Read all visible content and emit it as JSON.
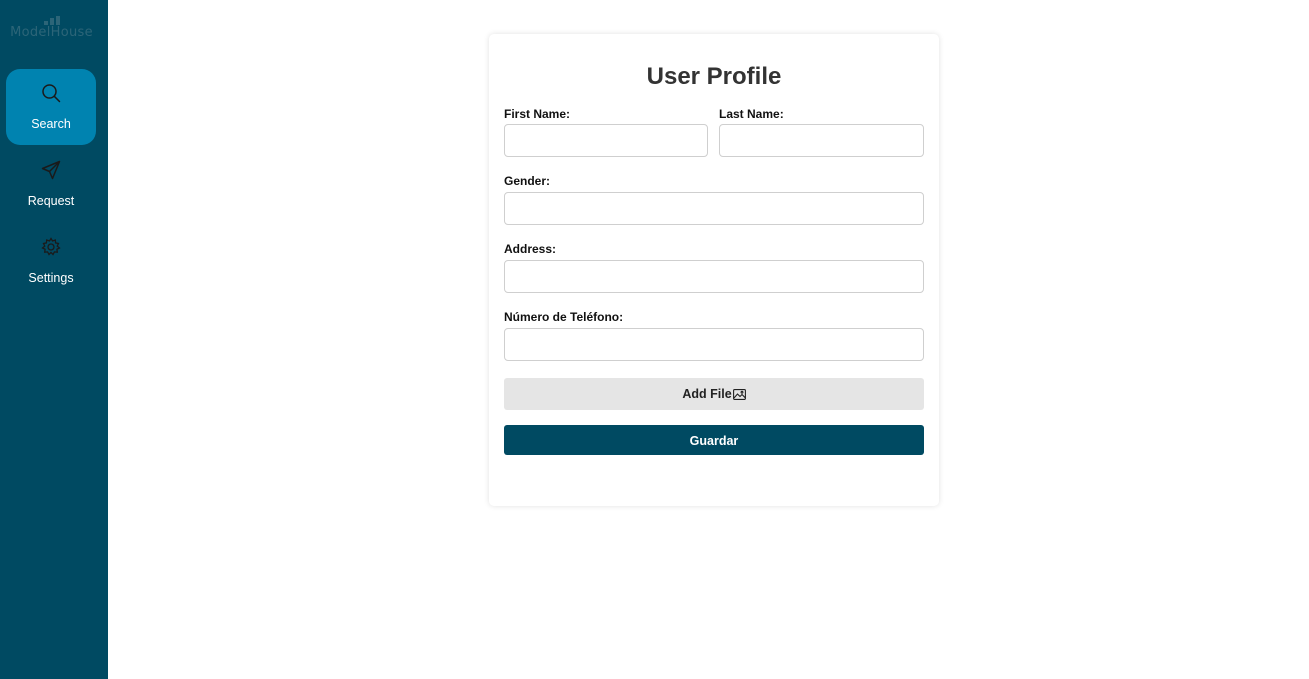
{
  "app": {
    "logo_text": "ModelHouse"
  },
  "sidebar": {
    "items": [
      {
        "label": "Search",
        "icon": "search-icon",
        "active": true
      },
      {
        "label": "Request",
        "icon": "send-icon",
        "active": false
      },
      {
        "label": "Settings",
        "icon": "gear-icon",
        "active": false
      }
    ]
  },
  "form": {
    "title": "User Profile",
    "first_name": {
      "label": "First Name:",
      "value": ""
    },
    "last_name": {
      "label": "Last Name:",
      "value": ""
    },
    "gender": {
      "label": "Gender:",
      "value": ""
    },
    "address": {
      "label": "Address:",
      "value": ""
    },
    "phone": {
      "label": "Número de Teléfono:",
      "value": ""
    },
    "add_file_label": "Add File",
    "save_label": "Guardar"
  },
  "colors": {
    "sidebar_bg": "#004a62",
    "active_nav": "#0083b0",
    "primary_button": "#004a62",
    "secondary_button": "#e5e5e5"
  }
}
